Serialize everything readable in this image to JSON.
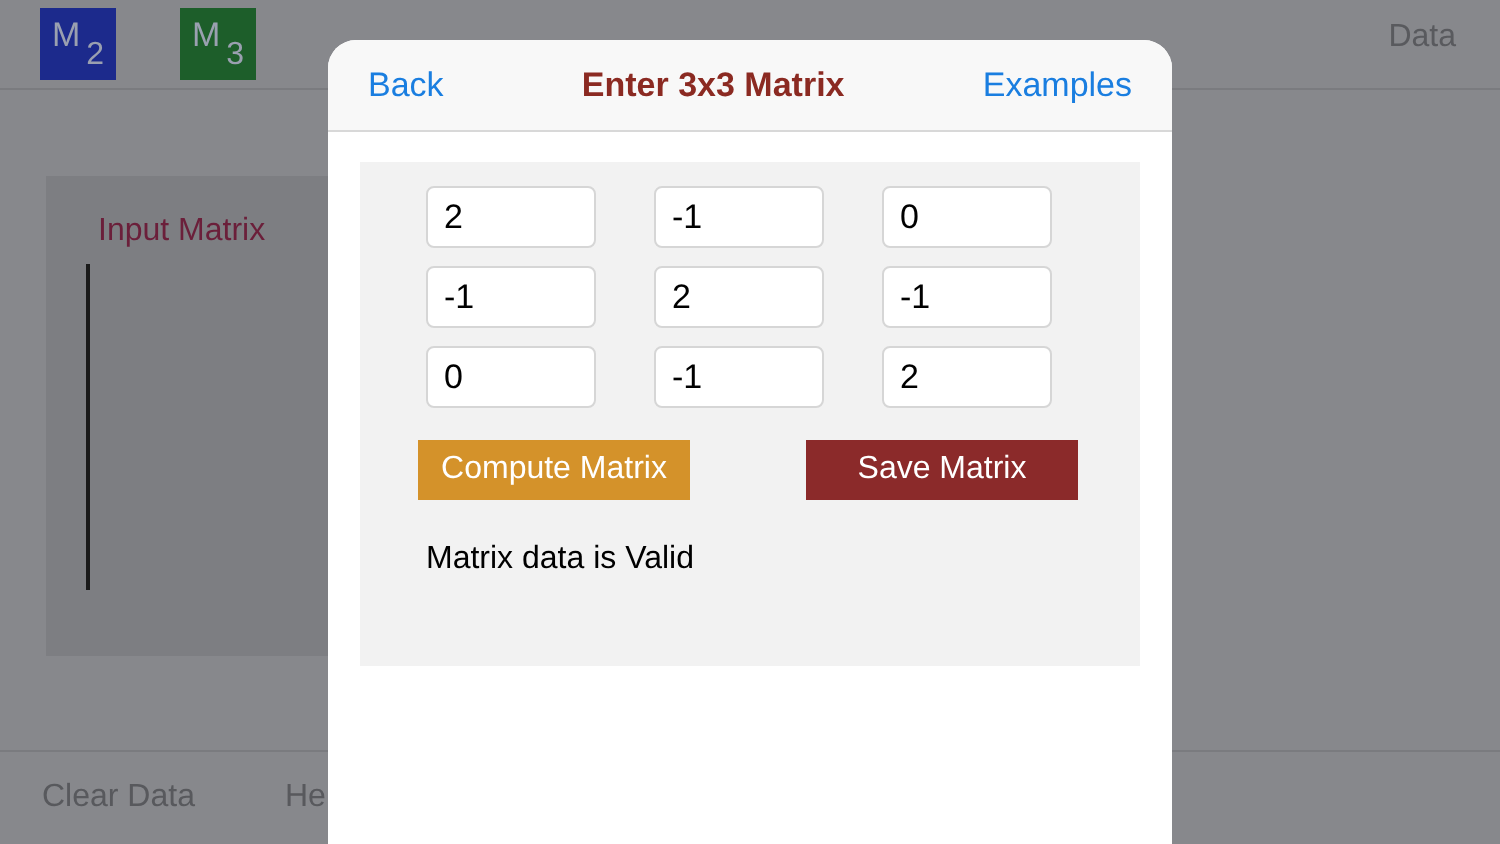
{
  "app": {
    "toolbar": {
      "buttons": [
        {
          "label": "M",
          "sub": "2",
          "color": "#1c2a8c"
        },
        {
          "label": "M",
          "sub": "3",
          "color": "#1d5e2a"
        }
      ],
      "right_button": "Data"
    },
    "panel": {
      "title": "Input Matrix"
    },
    "bottom_bar": [
      "Clear Data",
      "He"
    ]
  },
  "dialog": {
    "back": "Back",
    "title": "Enter 3x3 Matrix",
    "examples": "Examples",
    "matrix": [
      [
        "2",
        "-1",
        "0"
      ],
      [
        "-1",
        "2",
        "-1"
      ],
      [
        "0",
        "-1",
        "2"
      ]
    ],
    "buttons": [
      {
        "label": "Compute Matrix",
        "kind": "compute"
      },
      {
        "label": "Save Matrix",
        "kind": "save"
      }
    ],
    "status": "Matrix data is Valid"
  }
}
